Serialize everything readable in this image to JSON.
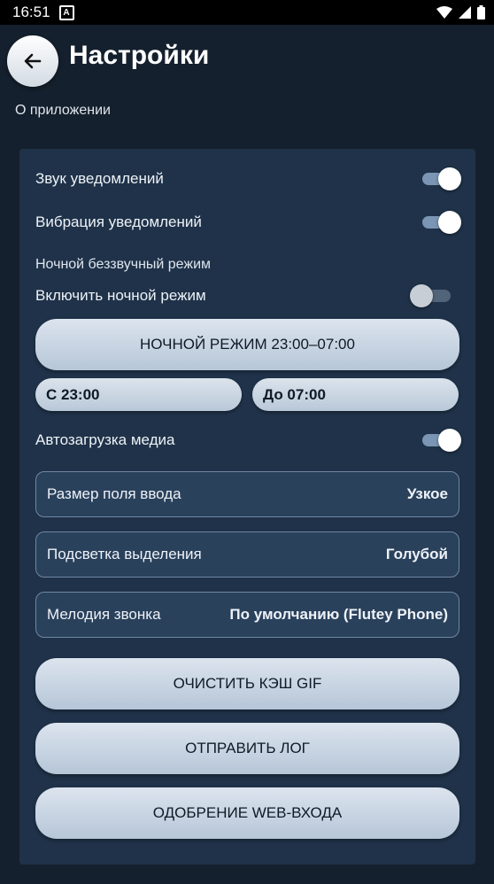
{
  "status_bar": {
    "time": "16:51",
    "badge": "A"
  },
  "header": {
    "title": "Настройки",
    "subtitle": "О приложении"
  },
  "settings": {
    "notification_sound": {
      "label": "Звук уведомлений",
      "on": true
    },
    "notification_vibration": {
      "label": "Вибрация уведомлений",
      "on": true
    },
    "night_section_label": "Ночной беззвучный режим",
    "night_mode": {
      "label": "Включить ночной режим",
      "on": false
    },
    "night_schedule_button": "НОЧНОЙ РЕЖИМ 23:00–07:00",
    "night_from": "С 23:00",
    "night_to": "До 07:00",
    "media_autoload": {
      "label": "Автозагрузка медиа",
      "on": true
    },
    "input_size": {
      "label": "Размер поля ввода",
      "value": "Узкое"
    },
    "highlight": {
      "label": "Подсветка выделения",
      "value": "Голубой"
    },
    "ringtone": {
      "label": "Мелодия звонка",
      "value": "По умолчанию (Flutey Phone)"
    }
  },
  "actions": {
    "clear_gif_cache": "ОЧИСТИТЬ КЭШ GIF",
    "send_log": "ОТПРАВИТЬ ЛОГ",
    "web_login_approval": "ОДОБРЕНИЕ WEB-ВХОДА"
  },
  "colors": {
    "background": "#15202e",
    "panel": "#1f3249",
    "accent": "#7a96b4"
  }
}
